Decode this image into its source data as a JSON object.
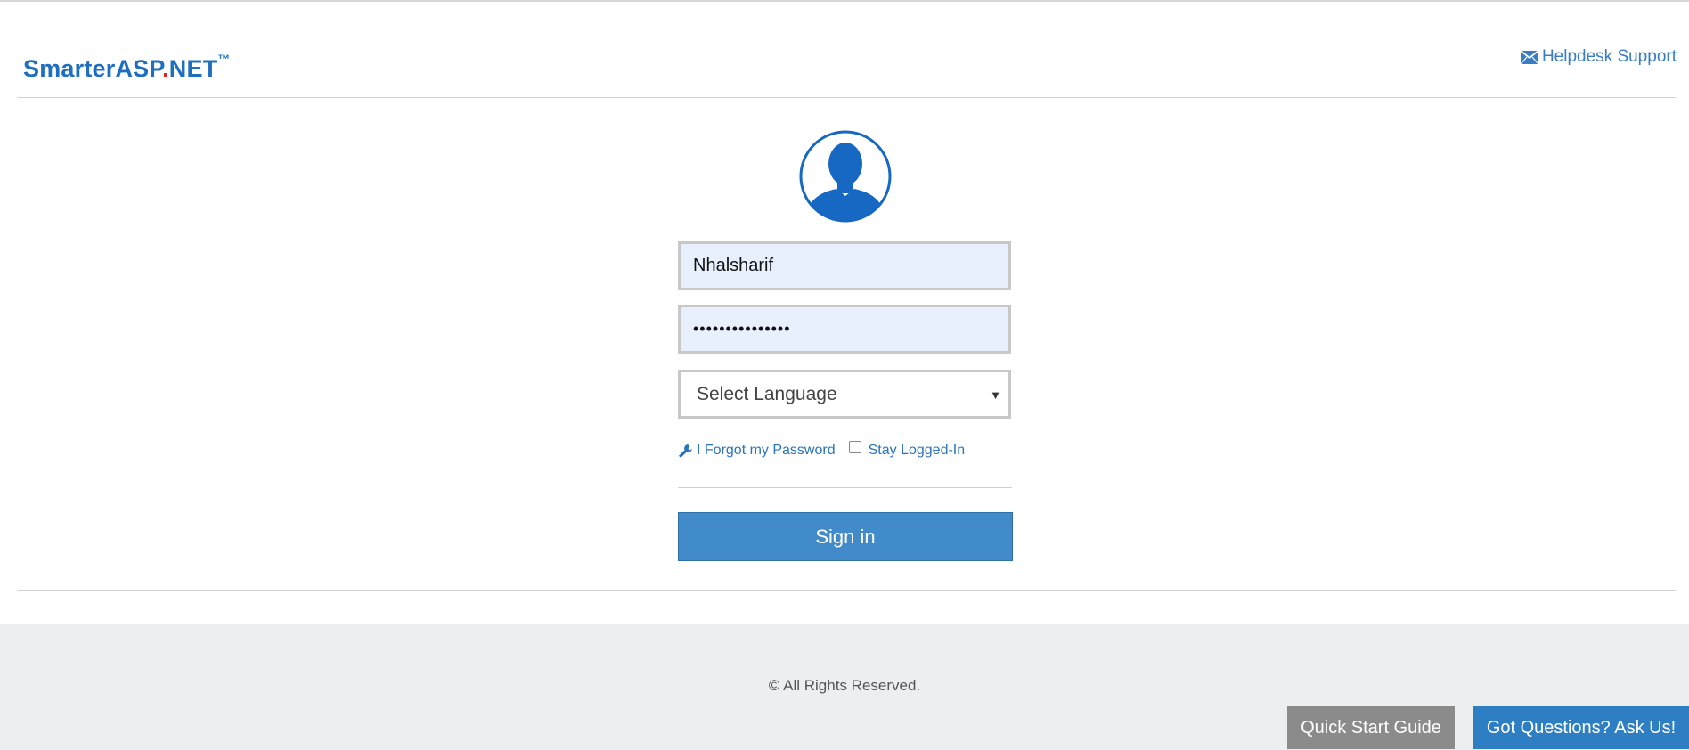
{
  "header": {
    "brand_main": "SmarterASP",
    "brand_dot": ".",
    "brand_tld": "NET",
    "brand_tm": "™",
    "helpdesk_label": "Helpdesk Support"
  },
  "login": {
    "username_value": "Nhalsharif",
    "password_value": "•••••••••••••••",
    "language_selected": "Select Language",
    "forgot_label": "I Forgot my Password",
    "stay_logged_label": "Stay Logged-In",
    "signin_label": "Sign in"
  },
  "footer": {
    "copyright": "© All Rights Reserved.",
    "quick_start_label": "Quick Start Guide",
    "ask_label": "Got Questions? Ask Us!"
  },
  "icons": {
    "helpdesk": "envelope-icon",
    "avatar": "user-silhouette-icon",
    "forgot": "wrench-icon",
    "select": "caret-down-icon"
  },
  "colors": {
    "brand_blue": "#1f6fc0",
    "brand_red": "#e3261b",
    "link_blue": "#2b73bb",
    "signin_blue": "#428bca",
    "ask_blue": "#2d7ec3",
    "quick_gray": "#8b8b8b",
    "input_fill": "#e8f0fe",
    "footer_bg": "#eceef0"
  }
}
